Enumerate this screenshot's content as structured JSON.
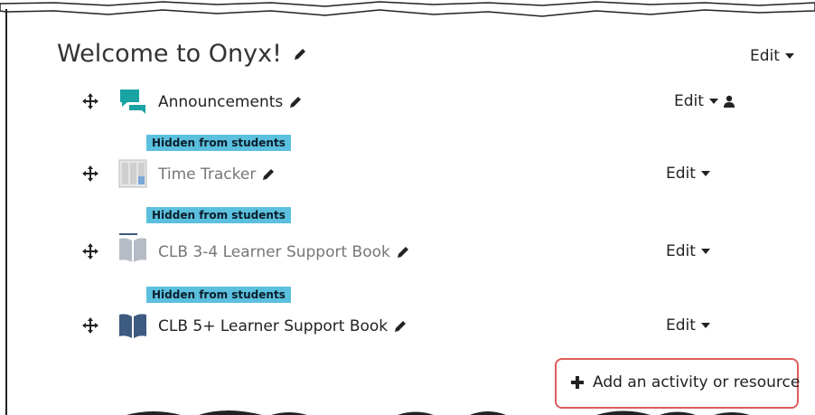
{
  "section": {
    "title": "Welcome to Onyx!",
    "edit_label": "Edit"
  },
  "activities": [
    {
      "name": "Announcements",
      "edit_label": "Edit",
      "icon": "forum-icon",
      "dimmed": false,
      "badge": ""
    },
    {
      "name": "Time Tracker",
      "edit_label": "Edit",
      "icon": "timetracker-icon",
      "dimmed": true,
      "badge": "Hidden from students"
    },
    {
      "name": "CLB 3-4 Learner Support Book",
      "edit_label": "Edit",
      "icon": "book-icon",
      "dimmed": true,
      "badge": "Hidden from students"
    },
    {
      "name": "CLB 5+ Learner Support Book",
      "edit_label": "Edit",
      "icon": "book-icon",
      "dimmed": false,
      "badge": "Hidden from students"
    }
  ],
  "add_activity": {
    "label": "Add an activity or resource"
  },
  "colors": {
    "badge": "#5bc0de",
    "forum": "#1aa3a3",
    "book": "#3d5a80",
    "highlight": "#e05b5b"
  }
}
